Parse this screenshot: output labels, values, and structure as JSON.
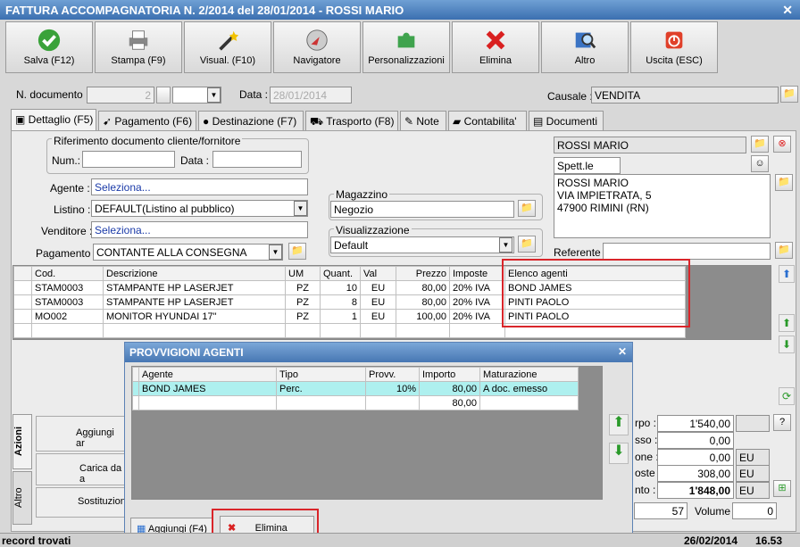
{
  "window": {
    "title": "FATTURA ACCOMPAGNATORIA N. 2/2014 del 28/01/2014 - ROSSI MARIO",
    "close": "✕"
  },
  "toolbar": [
    {
      "label": "Salva (F12)",
      "icon": "check-icon"
    },
    {
      "label": "Stampa (F9)",
      "icon": "printer-icon"
    },
    {
      "label": "Visual. (F10)",
      "icon": "wand-icon"
    },
    {
      "label": "Navigatore",
      "icon": "compass-icon"
    },
    {
      "label": "Personalizzazioni",
      "icon": "puzzle-icon"
    },
    {
      "label": "Elimina",
      "icon": "delete-x-icon"
    },
    {
      "label": "Altro",
      "icon": "magnifier-icon"
    },
    {
      "label": "Uscita (ESC)",
      "icon": "power-icon"
    }
  ],
  "header": {
    "ndoc_label": "N. documento :",
    "ndoc_value": "2",
    "data_label": "Data :",
    "data_value": "28/01/2014",
    "causale_label": "Causale :",
    "causale_value": "VENDITA"
  },
  "tabs": [
    "Dettaglio (F5)",
    "Pagamento (F6)",
    "Destinazione (F7)",
    "Trasporto (F8)",
    "Note",
    "Contabilita'",
    "Documenti"
  ],
  "rif": {
    "legend": "Riferimento documento cliente/fornitore",
    "num_label": "Num.:",
    "data_label": "Data :"
  },
  "form": {
    "agente_label": "Agente :",
    "agente_value": "Seleziona...",
    "listino_label": "Listino :",
    "listino_value": "DEFAULT(Listino al pubblico)",
    "venditore_label": "Venditore :",
    "venditore_value": "Seleziona...",
    "pagamento_label": "Pagamento :",
    "pagamento_value": "CONTANTE ALLA CONSEGNA"
  },
  "magazzino": {
    "legend": "Magazzino",
    "value": "Negozio"
  },
  "visual": {
    "legend": "Visualizzazione",
    "value": "Default"
  },
  "cliente": {
    "name": "ROSSI MARIO",
    "title": "Spett.le",
    "address": [
      "ROSSI MARIO",
      "VIA IMPIETRATA, 5",
      "47900 RIMINI (RN)"
    ],
    "referente_label": "Referente"
  },
  "grid": {
    "headers": [
      "Cod.",
      "Descrizione",
      "UM",
      "Quant.",
      "Val",
      "Prezzo",
      "Imposte",
      "Elenco agenti"
    ],
    "rows": [
      [
        "STAM0003",
        "STAMPANTE HP LASERJET",
        "PZ",
        "10",
        "EU",
        "80,00",
        "20% IVA",
        "BOND JAMES"
      ],
      [
        "STAM0003",
        "STAMPANTE HP LASERJET",
        "PZ",
        "8",
        "EU",
        "80,00",
        "20% IVA",
        "PINTI PAOLO"
      ],
      [
        "MO002",
        "MONITOR HYUNDAI 17\"",
        "PZ",
        "1",
        "EU",
        "100,00",
        "20% IVA",
        "PINTI PAOLO"
      ]
    ]
  },
  "azioni": {
    "tab1": "Azioni",
    "tab2": "Altro",
    "buttons": [
      "Aggiungi ar",
      "Carica da a",
      "Sostituzion"
    ]
  },
  "totals": {
    "rows": [
      {
        "label": "rpo :",
        "value": "1'540,00",
        "unit": ""
      },
      {
        "label": "sso :",
        "value": "0,00",
        "unit": ""
      },
      {
        "label": "one :",
        "value": "0,00",
        "unit": "EU"
      },
      {
        "label": "oste :",
        "value": "308,00",
        "unit": "EU"
      },
      {
        "label": "nto :",
        "value": "1'848,00",
        "unit": "EU"
      }
    ],
    "help": "?",
    "colli": "57",
    "volume_label": "Volume :",
    "volume_value": "0"
  },
  "dialog": {
    "title": "PROVVIGIONI AGENTI",
    "close": "✕",
    "headers": [
      "Agente",
      "Tipo",
      "Provv.",
      "Importo",
      "Maturazione"
    ],
    "rows": [
      [
        "BOND JAMES",
        "Perc.",
        "10%",
        "80,00",
        "A doc. emesso"
      ],
      [
        "",
        "",
        "",
        "80,00",
        ""
      ]
    ],
    "add_label": "Aggiungi (F4)",
    "delete_label": "Elimina"
  },
  "status": {
    "left": "record trovati",
    "date": "26/02/2014",
    "time": "16.53"
  }
}
